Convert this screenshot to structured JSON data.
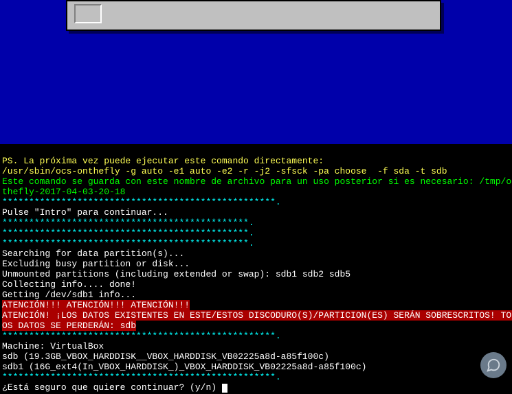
{
  "ps_line1": "PS. La próxima vez puede ejecutar este comando directamente:",
  "ps_line2": "/usr/sbin/ocs-onthefly -g auto -e1 auto -e2 -r -j2 -sfsck -pa choose  -f sda -t sdb",
  "save_line1": "Este comando se guarda con este nombre de archivo para un uso posterior si es necesario: /tmp/ocs-on",
  "save_line2": "thefly-2017-04-03-20-18",
  "stars_long": "***************************************************.",
  "stars_short": "**********************************************.",
  "press_intro": "Pulse \"Intro\" para continuar...",
  "searching": "Searching for data partition(s)...",
  "excluding": "Excluding busy partition or disk...",
  "unmounted": "Unmounted partitions (including extended or swap): sdb1 sdb2 sdb5",
  "collecting": "Collecting info.... done!",
  "getting": "Getting /dev/sdb1 info...",
  "warn1": "ATENCIÓN!!! ATENCIÓN!!! ATENCIÓN!!!",
  "warn2a": "ATENCIÓN! ¡LOS DATOS EXISTENTES EN ESTE/ESTOS DISCODURO(S)/PARTICION(ES) SERÁN SOBRESCRITOS! TODOS L",
  "warn2b": "OS DATOS SE PERDERÁN: sdb",
  "machine": "Machine: VirtualBox",
  "sdb": "sdb (19.3GB_VBOX_HARDDISK__VBOX_HARDDISK_VB02225a8d-a85f100c)",
  "sdb1": "sdb1 (16G_ext4(In_VBOX_HARDDISK_)_VBOX_HARDDISK_VB02225a8d-a85f100c)",
  "confirm": "¿Está seguro que quiere continuar? (y/n) "
}
